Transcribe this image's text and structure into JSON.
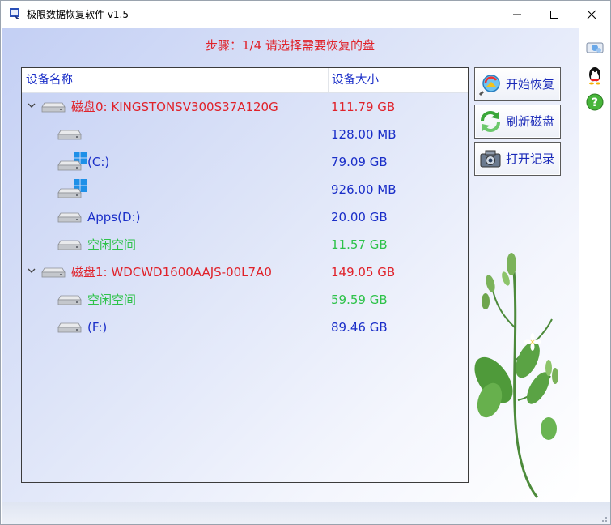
{
  "window": {
    "title": "极限数据恢复软件 v1.5"
  },
  "step": {
    "label": "步骤：1/4 请选择需要恢复的盘"
  },
  "columns": {
    "name": "设备名称",
    "size": "设备大小"
  },
  "tree": [
    {
      "level": 0,
      "icon": "disk-icon",
      "expander": true,
      "name": "磁盘0: KINGSTONSV300S37A120G",
      "size": "111.79 GB",
      "color": "#e0222a"
    },
    {
      "level": 1,
      "icon": "disk-icon",
      "expander": false,
      "name": "",
      "size": "128.00 MB",
      "color": "#1a2ec8"
    },
    {
      "level": 1,
      "icon": "windows-disk-icon",
      "expander": false,
      "name": "(C:)",
      "size": "79.09 GB",
      "color": "#1a2ec8"
    },
    {
      "level": 1,
      "icon": "windows-disk-icon",
      "expander": false,
      "name": "",
      "size": "926.00 MB",
      "color": "#1a2ec8"
    },
    {
      "level": 1,
      "icon": "disk-icon",
      "expander": false,
      "name": "Apps(D:)",
      "size": "20.00 GB",
      "color": "#1a2ec8"
    },
    {
      "level": 1,
      "icon": "disk-icon",
      "expander": false,
      "name": "空闲空间",
      "size": "11.57 GB",
      "color": "#2ec24a"
    },
    {
      "level": 0,
      "icon": "disk-icon",
      "expander": true,
      "name": "磁盘1: WDCWD1600AAJS-00L7A0",
      "size": "149.05 GB",
      "color": "#e0222a"
    },
    {
      "level": 1,
      "icon": "disk-icon",
      "expander": false,
      "name": "空闲空间",
      "size": "59.59 GB",
      "color": "#2ec24a"
    },
    {
      "level": 1,
      "icon": "disk-icon",
      "expander": false,
      "name": "(F:)",
      "size": "89.46 GB",
      "color": "#1a2ec8"
    }
  ],
  "buttons": {
    "start_recovery": "开始恢复",
    "refresh_disks": "刷新磁盘",
    "open_log": "打开记录"
  },
  "side_icons": [
    "network-icon",
    "qq-penguin-icon",
    "help-icon"
  ],
  "colors": {
    "accent_red": "#e0222a",
    "text_blue": "#1a2ec8",
    "free_green": "#2ec24a"
  }
}
